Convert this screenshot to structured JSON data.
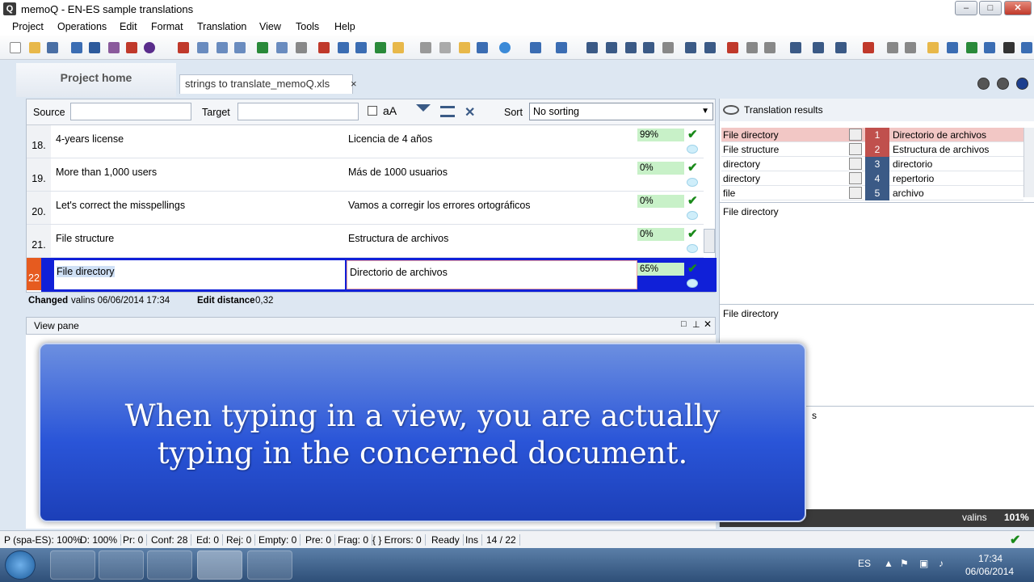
{
  "window": {
    "title": "memoQ - EN-ES sample translations",
    "app_icon": "Q",
    "minimize": "–",
    "maximize": "□",
    "close": "✕"
  },
  "menu": [
    "Project",
    "Operations",
    "Edit",
    "Format",
    "Translation",
    "View",
    "Tools",
    "Help"
  ],
  "tabs": {
    "home": "Project home",
    "doc": "strings to translate_memoQ.xls",
    "doc_close": "×"
  },
  "filter": {
    "source_label": "Source",
    "target_label": "Target",
    "case_label": "aA",
    "sort_label": "Sort",
    "sort_value": "No sorting"
  },
  "rows": [
    {
      "num": "18.",
      "source": "4-years license",
      "target": "Licencia de 4 años",
      "match": "99%"
    },
    {
      "num": "19.",
      "source": "More than 1,000 users",
      "target": "Más de 1000 usuarios",
      "match": "0%"
    },
    {
      "num": "20.",
      "source": "Let's correct the misspellings",
      "target": "Vamos a corregir los errores ortográficos",
      "match": "0%"
    },
    {
      "num": "21.",
      "source": "File structure",
      "target": "Estructura de archivos",
      "match": "0%"
    }
  ],
  "active_row": {
    "num": "22",
    "source": "File directory",
    "target": "Directorio de archivos",
    "match": "65%"
  },
  "info": {
    "changed_label": "Changed",
    "changed_value": "valins 06/06/2014 17:34",
    "edit_distance_label": "Edit distance",
    "edit_distance_value": "0,32"
  },
  "view_pane": {
    "title": "View pane"
  },
  "translation_results": {
    "title": "Translation results",
    "hits": [
      {
        "source": "File directory",
        "num": "1",
        "target": "Directorio de archivos",
        "color": "#c0504d",
        "bg": "#f2c7c5"
      },
      {
        "source": "File structure",
        "num": "2",
        "target": "Estructura de archivos",
        "color": "#c0504d",
        "bg": "#ffffff"
      },
      {
        "source": "directory",
        "num": "3",
        "target": "directorio",
        "color": "#3b5a86",
        "bg": "#ffffff"
      },
      {
        "source": "directory",
        "num": "4",
        "target": "repertorio",
        "color": "#3b5a86",
        "bg": "#ffffff"
      },
      {
        "source": "file",
        "num": "5",
        "target": "archivo",
        "color": "#3b5a86",
        "bg": "#ffffff"
      }
    ],
    "source_preview": "File directory",
    "target_preview": "File directory",
    "partial_text": "s",
    "footer_user": "valins",
    "zoom": "101%"
  },
  "overlay": {
    "line1": "When typing in a view, you are actually",
    "line2": "typing in the concerned document."
  },
  "status": [
    "P (spa-ES): 100%",
    "D: 100%",
    "Pr: 0",
    "Conf: 28",
    "Ed: 0",
    "Rej: 0",
    "Empty: 0",
    "Pre: 0",
    "Frag: 0",
    "{ } Errors: 0",
    "Ready",
    "Ins",
    "14 / 22"
  ],
  "tray": {
    "lang": "ES",
    "time": "17:34",
    "date": "06/06/2014"
  }
}
